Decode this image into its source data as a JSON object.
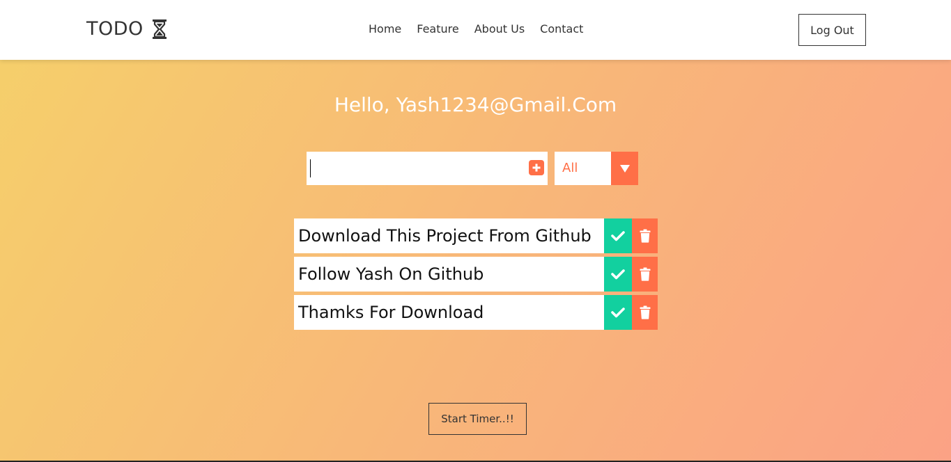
{
  "header": {
    "brand": "TODO",
    "nav": [
      "Home",
      "Feature",
      "About Us",
      "Contact"
    ],
    "logout_label": "Log Out"
  },
  "main": {
    "greeting": "Hello, Yash1234@Gmail.Com",
    "input_value": "",
    "filter_selected": "All",
    "todos": [
      "Download This Project From Github",
      "Follow Yash On Github",
      "Thamks For Download"
    ],
    "timer_label": "Start Timer..!!"
  },
  "icons": {
    "brand": "hourglass-icon",
    "add": "plus-square-icon",
    "filter": "caret-down-icon",
    "complete": "check-icon",
    "delete": "trash-icon"
  },
  "colors": {
    "accent": "#ff6f47",
    "complete": "#12d09f",
    "gradient_start": "#f5d06a",
    "gradient_end": "#fba285"
  }
}
